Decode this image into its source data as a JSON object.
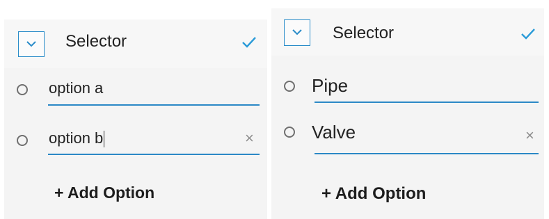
{
  "colors": {
    "accent": "#2a8cc9",
    "panel_bg": "#f4f4f4",
    "text": "#222222",
    "remove_icon": "#8d8d8d"
  },
  "panels": [
    {
      "title": "Selector",
      "options": [
        {
          "value": "option a",
          "has_remove": false,
          "has_cursor": false
        },
        {
          "value": "option b",
          "has_remove": true,
          "has_cursor": true
        }
      ],
      "add_label": "+ Add Option",
      "remove_symbol": "×",
      "icons": [
        "chevron-down-icon",
        "check-icon",
        "radio-icon",
        "close-icon"
      ]
    },
    {
      "title": "Selector",
      "options": [
        {
          "value": "Pipe",
          "has_remove": false,
          "has_cursor": false
        },
        {
          "value": "Valve",
          "has_remove": true,
          "has_cursor": false
        }
      ],
      "add_label": "+ Add Option",
      "remove_symbol": "×",
      "icons": [
        "chevron-down-icon",
        "check-icon",
        "radio-icon",
        "close-icon"
      ]
    }
  ]
}
